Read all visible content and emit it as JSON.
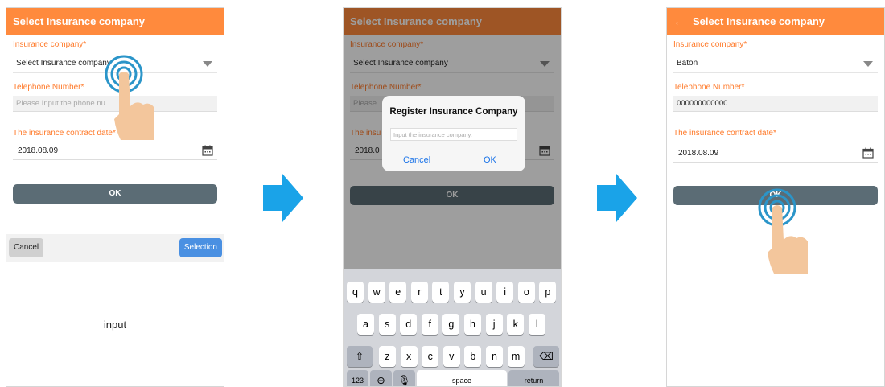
{
  "screens": [
    {
      "header": "Select Insurance company",
      "insurance_label": "Insurance company*",
      "insurance_value": "Select Insurance company",
      "phone_label": "Telephone Number*",
      "phone_placeholder": "Please Input the phone nu",
      "date_label": "The insurance contract date*",
      "date_value": "2018.08.09",
      "ok_label": "OK",
      "picker": {
        "cancel": "Cancel",
        "selection": "Selection",
        "option": "input"
      }
    },
    {
      "header": "Select Insurance company",
      "insurance_label": "Insurance company*",
      "insurance_value": "Select Insurance company",
      "phone_label": "Telephone Number*",
      "phone_placeholder": "Please",
      "date_label": "The insu",
      "date_value": "2018.0",
      "ok_label": "OK",
      "dialog": {
        "title": "Register Insurance Company",
        "input_placeholder": "Input the insurance company.",
        "cancel": "Cancel",
        "ok": "OK"
      },
      "keyboard": {
        "row1": [
          "q",
          "w",
          "e",
          "r",
          "t",
          "y",
          "u",
          "i",
          "o",
          "p"
        ],
        "row2": [
          "a",
          "s",
          "d",
          "f",
          "g",
          "h",
          "j",
          "k",
          "l"
        ],
        "row3": [
          "z",
          "x",
          "c",
          "v",
          "b",
          "n",
          "m"
        ],
        "numbers": "123",
        "space": "space",
        "return": "return"
      }
    },
    {
      "header": "Select Insurance company",
      "back_icon": "←",
      "insurance_label": "Insurance company*",
      "insurance_value": "Baton",
      "phone_label": "Telephone Number*",
      "phone_value": "000000000000",
      "date_label": "The insurance contract date*",
      "date_value": "2018.08.09",
      "ok_label": "OK"
    }
  ],
  "colors": {
    "header": "#ff8a3d",
    "label": "#ff7a2a",
    "ok_button": "#5b6c75",
    "arrow": "#1aa3e8",
    "selection_button": "#4a90e2"
  }
}
